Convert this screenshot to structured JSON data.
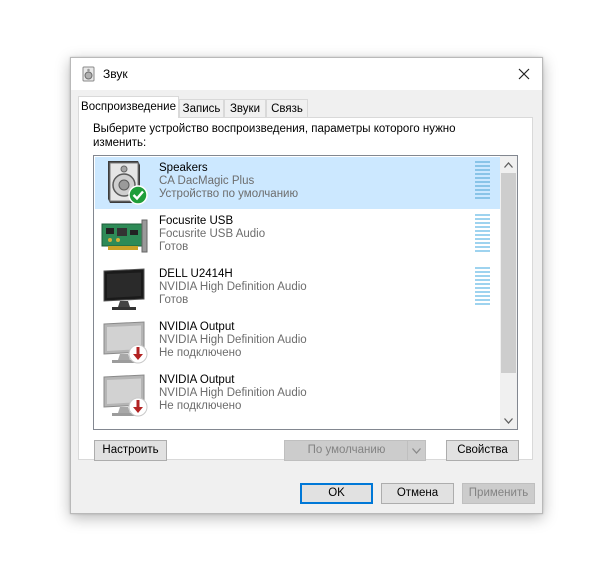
{
  "window": {
    "title": "Звук",
    "icon": "speaker-icon"
  },
  "tabs": [
    {
      "label": "Воспроизведение",
      "active": true
    },
    {
      "label": "Запись",
      "active": false
    },
    {
      "label": "Звуки",
      "active": false
    },
    {
      "label": "Связь",
      "active": false
    }
  ],
  "instruction": "Выберите устройство воспроизведения, параметры которого нужно изменить:",
  "devices": [
    {
      "name": "Speakers",
      "subtitle": "CA DacMagic Plus",
      "state": "Устройство по умолчанию",
      "icon": "speaker-icon",
      "badge": "default-check-icon",
      "selected": true
    },
    {
      "name": "Focusrite USB",
      "subtitle": "Focusrite USB Audio",
      "state": "Готов",
      "icon": "sound-card-icon",
      "selected": false
    },
    {
      "name": "DELL U2414H",
      "subtitle": "NVIDIA High Definition Audio",
      "state": "Готов",
      "icon": "monitor-icon",
      "selected": false
    },
    {
      "name": "NVIDIA Output",
      "subtitle": "NVIDIA High Definition Audio",
      "state": "Не подключено",
      "icon": "monitor-icon",
      "badge": "disconnected-arrow-icon",
      "selected": false
    },
    {
      "name": "NVIDIA Output",
      "subtitle": "NVIDIA High Definition Audio",
      "state": "Не подключено",
      "icon": "monitor-icon",
      "badge": "disconnected-arrow-icon",
      "selected": false
    }
  ],
  "buttons": {
    "configure": "Настроить",
    "set_default": "По умолчанию",
    "properties": "Свойства",
    "ok": "OK",
    "cancel": "Отмена",
    "apply": "Применить"
  },
  "colors": {
    "selection": "#cce8ff",
    "accent": "#0078d7",
    "check_badge": "#16a34a",
    "disconnected_badge": "#c0392b"
  }
}
